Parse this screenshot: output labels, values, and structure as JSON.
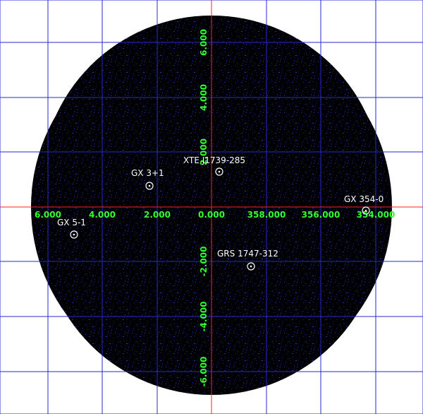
{
  "colors": {
    "background": "#ffffff",
    "sky": "#000000",
    "photon_dots": "#1e2aa8",
    "grid": "#2a2acc",
    "axis": "#ff2020",
    "tick_labels": "#33ff33",
    "source_labels": "#ffffff",
    "source_markers": "#ffffff"
  },
  "axes": {
    "longitude_ticks": [
      "6.000",
      "4.000",
      "2.000",
      "0.000",
      "358.000",
      "356.000",
      "354.000"
    ],
    "latitude_ticks": [
      "6.000",
      "4.000",
      "2.000",
      "-2.000",
      "-4.000",
      "-6.000"
    ]
  },
  "sources": [
    {
      "name": "XTE J1739-285"
    },
    {
      "name": "GX 3+1"
    },
    {
      "name": "GX 354-0"
    },
    {
      "name": "GX 5-1"
    },
    {
      "name": "GRS 1747-312"
    }
  ]
}
